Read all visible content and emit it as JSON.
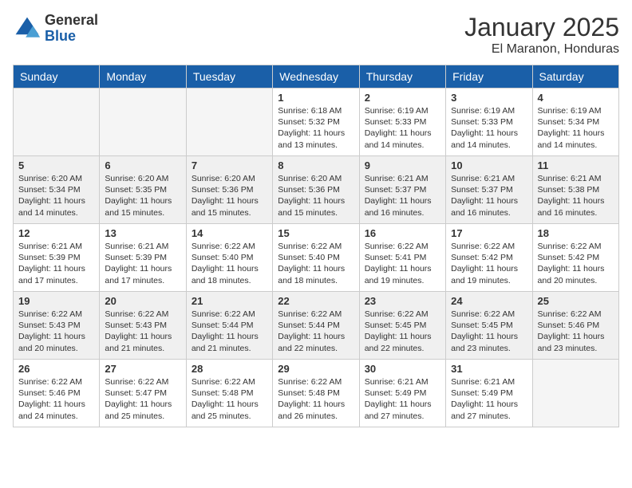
{
  "logo": {
    "general": "General",
    "blue": "Blue"
  },
  "title": "January 2025",
  "subtitle": "El Maranon, Honduras",
  "headers": [
    "Sunday",
    "Monday",
    "Tuesday",
    "Wednesday",
    "Thursday",
    "Friday",
    "Saturday"
  ],
  "weeks": [
    [
      {
        "num": "",
        "info": ""
      },
      {
        "num": "",
        "info": ""
      },
      {
        "num": "",
        "info": ""
      },
      {
        "num": "1",
        "info": "Sunrise: 6:18 AM\nSunset: 5:32 PM\nDaylight: 11 hours\nand 13 minutes."
      },
      {
        "num": "2",
        "info": "Sunrise: 6:19 AM\nSunset: 5:33 PM\nDaylight: 11 hours\nand 14 minutes."
      },
      {
        "num": "3",
        "info": "Sunrise: 6:19 AM\nSunset: 5:33 PM\nDaylight: 11 hours\nand 14 minutes."
      },
      {
        "num": "4",
        "info": "Sunrise: 6:19 AM\nSunset: 5:34 PM\nDaylight: 11 hours\nand 14 minutes."
      }
    ],
    [
      {
        "num": "5",
        "info": "Sunrise: 6:20 AM\nSunset: 5:34 PM\nDaylight: 11 hours\nand 14 minutes."
      },
      {
        "num": "6",
        "info": "Sunrise: 6:20 AM\nSunset: 5:35 PM\nDaylight: 11 hours\nand 15 minutes."
      },
      {
        "num": "7",
        "info": "Sunrise: 6:20 AM\nSunset: 5:36 PM\nDaylight: 11 hours\nand 15 minutes."
      },
      {
        "num": "8",
        "info": "Sunrise: 6:20 AM\nSunset: 5:36 PM\nDaylight: 11 hours\nand 15 minutes."
      },
      {
        "num": "9",
        "info": "Sunrise: 6:21 AM\nSunset: 5:37 PM\nDaylight: 11 hours\nand 16 minutes."
      },
      {
        "num": "10",
        "info": "Sunrise: 6:21 AM\nSunset: 5:37 PM\nDaylight: 11 hours\nand 16 minutes."
      },
      {
        "num": "11",
        "info": "Sunrise: 6:21 AM\nSunset: 5:38 PM\nDaylight: 11 hours\nand 16 minutes."
      }
    ],
    [
      {
        "num": "12",
        "info": "Sunrise: 6:21 AM\nSunset: 5:39 PM\nDaylight: 11 hours\nand 17 minutes."
      },
      {
        "num": "13",
        "info": "Sunrise: 6:21 AM\nSunset: 5:39 PM\nDaylight: 11 hours\nand 17 minutes."
      },
      {
        "num": "14",
        "info": "Sunrise: 6:22 AM\nSunset: 5:40 PM\nDaylight: 11 hours\nand 18 minutes."
      },
      {
        "num": "15",
        "info": "Sunrise: 6:22 AM\nSunset: 5:40 PM\nDaylight: 11 hours\nand 18 minutes."
      },
      {
        "num": "16",
        "info": "Sunrise: 6:22 AM\nSunset: 5:41 PM\nDaylight: 11 hours\nand 19 minutes."
      },
      {
        "num": "17",
        "info": "Sunrise: 6:22 AM\nSunset: 5:42 PM\nDaylight: 11 hours\nand 19 minutes."
      },
      {
        "num": "18",
        "info": "Sunrise: 6:22 AM\nSunset: 5:42 PM\nDaylight: 11 hours\nand 20 minutes."
      }
    ],
    [
      {
        "num": "19",
        "info": "Sunrise: 6:22 AM\nSunset: 5:43 PM\nDaylight: 11 hours\nand 20 minutes."
      },
      {
        "num": "20",
        "info": "Sunrise: 6:22 AM\nSunset: 5:43 PM\nDaylight: 11 hours\nand 21 minutes."
      },
      {
        "num": "21",
        "info": "Sunrise: 6:22 AM\nSunset: 5:44 PM\nDaylight: 11 hours\nand 21 minutes."
      },
      {
        "num": "22",
        "info": "Sunrise: 6:22 AM\nSunset: 5:44 PM\nDaylight: 11 hours\nand 22 minutes."
      },
      {
        "num": "23",
        "info": "Sunrise: 6:22 AM\nSunset: 5:45 PM\nDaylight: 11 hours\nand 22 minutes."
      },
      {
        "num": "24",
        "info": "Sunrise: 6:22 AM\nSunset: 5:45 PM\nDaylight: 11 hours\nand 23 minutes."
      },
      {
        "num": "25",
        "info": "Sunrise: 6:22 AM\nSunset: 5:46 PM\nDaylight: 11 hours\nand 23 minutes."
      }
    ],
    [
      {
        "num": "26",
        "info": "Sunrise: 6:22 AM\nSunset: 5:46 PM\nDaylight: 11 hours\nand 24 minutes."
      },
      {
        "num": "27",
        "info": "Sunrise: 6:22 AM\nSunset: 5:47 PM\nDaylight: 11 hours\nand 25 minutes."
      },
      {
        "num": "28",
        "info": "Sunrise: 6:22 AM\nSunset: 5:48 PM\nDaylight: 11 hours\nand 25 minutes."
      },
      {
        "num": "29",
        "info": "Sunrise: 6:22 AM\nSunset: 5:48 PM\nDaylight: 11 hours\nand 26 minutes."
      },
      {
        "num": "30",
        "info": "Sunrise: 6:21 AM\nSunset: 5:49 PM\nDaylight: 11 hours\nand 27 minutes."
      },
      {
        "num": "31",
        "info": "Sunrise: 6:21 AM\nSunset: 5:49 PM\nDaylight: 11 hours\nand 27 minutes."
      },
      {
        "num": "",
        "info": ""
      }
    ]
  ]
}
